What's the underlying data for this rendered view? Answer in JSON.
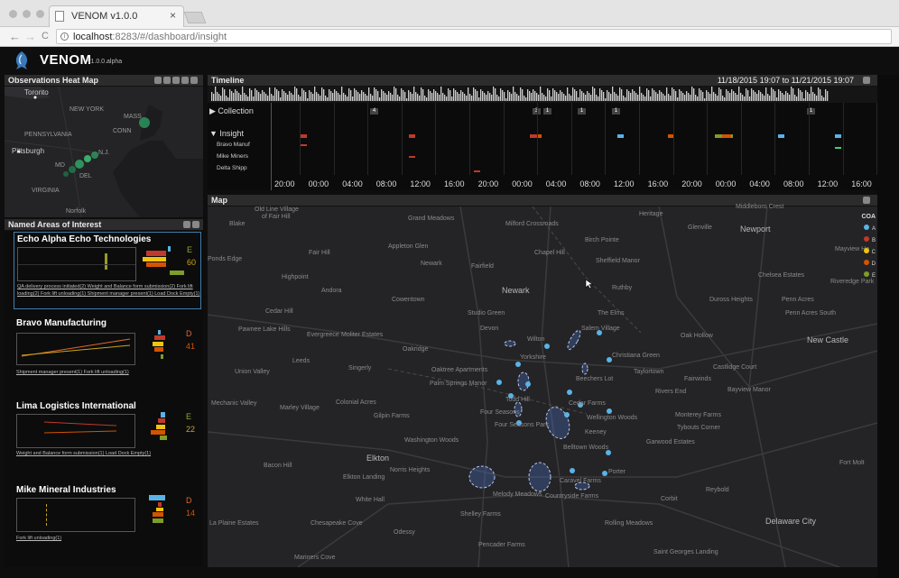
{
  "browser": {
    "tab_title": "VENOM v1.0.0",
    "close": "×",
    "back": "←",
    "forward": "→",
    "reload": "C",
    "url_host": "localhost",
    "url_rest": ":8283/#/dashboard/insight"
  },
  "app": {
    "name": "VENOM",
    "version": "v1.0.0.alpha"
  },
  "heatmap": {
    "title": "Observations Heat Map",
    "labels": {
      "toronto": "Toronto",
      "new_york": "NEW YORK",
      "mass": "MASS",
      "conn": "CONN",
      "pennsylvania": "PENNSYLVANIA",
      "pittsburgh": "Pittsburgh",
      "nj": "N.J.",
      "md": "MD",
      "del": "DEL",
      "virginia": "VIRGINIA",
      "norfolk": "Norfolk"
    }
  },
  "areas": {
    "title": "Named Areas of Interest",
    "cards": [
      {
        "title": "Echo Alpha Echo Technologies",
        "grade": "E",
        "score": "60",
        "links": "QA delivery process initiated(2) Weight and Balance form submission(2) Fork lift loading(2) Fork lift unloading(1) Shipment manager present(1) Load Dock Empty(1)"
      },
      {
        "title": "Bravo Manufacturing",
        "grade": "D",
        "score": "41",
        "links": "Shipment manager present(1) Fork lift unloading(1)"
      },
      {
        "title": "Lima Logistics International",
        "grade": "E",
        "score": "22",
        "links": "Weight and Balance form submission(1) Load Dock Empty(1)"
      },
      {
        "title": "Mike Mineral Industries",
        "grade": "D",
        "score": "14",
        "links": "Fork lift unloading(1)"
      }
    ]
  },
  "timeline": {
    "title": "Timeline",
    "range": "11/18/2015 19:07 to 11/21/2015 19:07",
    "collection": "Collection",
    "insight": "Insight",
    "sub_rows": [
      "Bravo Manuf",
      "Mike Miners",
      "Delta Shipp"
    ],
    "ticks": [
      "20:00",
      "00:00",
      "04:00",
      "08:00",
      "12:00",
      "16:00",
      "20:00",
      "00:00",
      "04:00",
      "08:00",
      "12:00",
      "16:00",
      "20:00",
      "00:00",
      "04:00",
      "08:00",
      "12:00",
      "16:00"
    ],
    "badges": [
      "4",
      "3",
      "1",
      "1",
      "1",
      "1"
    ]
  },
  "map": {
    "title": "Map",
    "legend_title": "COA",
    "legend": [
      {
        "label": "A",
        "color": "#5ab3e6"
      },
      {
        "label": "B",
        "color": "#c0392b"
      },
      {
        "label": "C",
        "color": "#f1c40f"
      },
      {
        "label": "D",
        "color": "#d35400"
      },
      {
        "label": "E",
        "color": "#7f9c2a"
      }
    ],
    "towns": [
      "Old Line Village",
      "of Fair Hill",
      "Grand Meadows",
      "Milford Crossroads",
      "Heritage",
      "Middleboro Crest",
      "Blake",
      "Glenville",
      "Newport",
      "Mayview He",
      "Appleton Glen",
      "Birch Pointe",
      "Fair Hill",
      "Chapel Hill",
      "Ponds Edge",
      "Newark",
      "Sheffield Manor",
      "Fairfield",
      "Highpoint",
      "Chelsea Estates",
      "Riveredge Park",
      "Andora",
      "Newark",
      "Ruthby",
      "Cowentown",
      "Duross Heights",
      "Penn Acres",
      "Cedar Hill",
      "Studio Green",
      "The Elms",
      "Penn Acres South",
      "Pawnee Lake Hills",
      "Evergreece",
      "Moliter Estates",
      "Devon",
      "Salem Village",
      "Oak Hollow",
      "New Castle",
      "Wilton",
      "Oakridge",
      "Christiana Green",
      "Leeds",
      "Yorkshire",
      "Taylortown",
      "Union Valley",
      "Singerly",
      "Oaktree Apartments",
      "Beechers Lot",
      "Fairwinds",
      "Castlidge Court",
      "Palm Springs Manor",
      "Rivers End",
      "Bayview Manor",
      "Mechanic Valley",
      "Marley Village",
      "Colonial Acres",
      "Todd Hill",
      "Cedar Farms",
      "Four Seasons",
      "Monterey Farms",
      "Gilpin Farms",
      "Wellington Woods",
      "Four Seasons Park",
      "Tybouts Corner",
      "Keeney",
      "Washington Woods",
      "Garwood Estates",
      "Belltown Woods",
      "Elkton",
      "Fort Molt",
      "Bacon Hill",
      "Norris Heights",
      "Porter",
      "Elkton Landing",
      "Caravel Farms",
      "Reybold",
      "Melody Meadows",
      "White Hall",
      "Countryside Farms",
      "Corbit",
      "Shelley Farms",
      "La Plaine Estates",
      "Chesapeake Cove",
      "Rolling Meadows",
      "Delaware City",
      "Odessy",
      "Pencader Farms",
      "Mariners Cove",
      "Saint Georges Landing"
    ]
  }
}
